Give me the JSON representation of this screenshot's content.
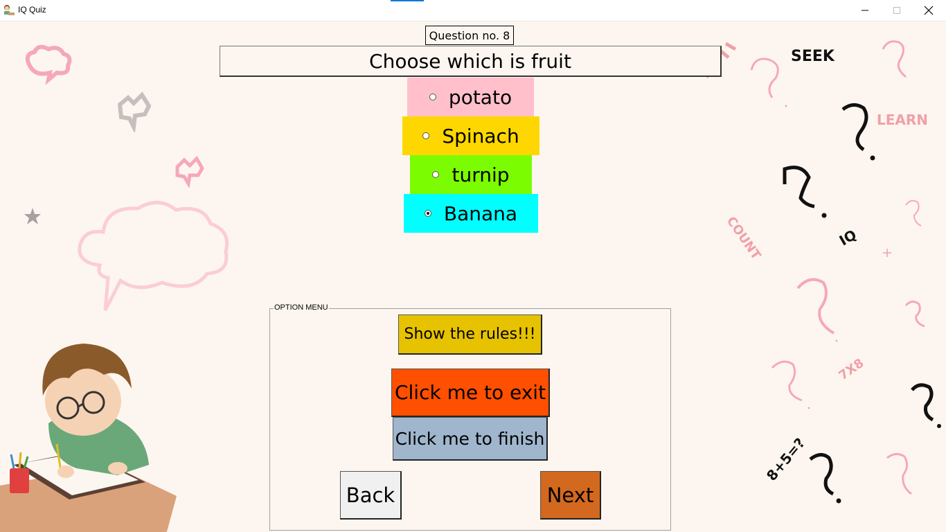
{
  "window": {
    "title": "IQ Quiz",
    "icon": "student-icon",
    "controls": [
      "minimize-icon",
      "maximize-icon",
      "close-icon"
    ]
  },
  "question": {
    "number_label": "Question no. 8",
    "text": "Choose which is fruit"
  },
  "options": [
    {
      "label": "potato",
      "color": "#ffc0cb",
      "selected": false
    },
    {
      "label": "Spinach",
      "color": "#ffd700",
      "selected": false
    },
    {
      "label": "turnip",
      "color": "#7cfc00",
      "selected": false
    },
    {
      "label": "Banana",
      "color": "#00ffff",
      "selected": true
    }
  ],
  "menu": {
    "label": "OPTION MENU",
    "rules_label": "Show the rules!!!",
    "exit_label": "Click me to exit",
    "finish_label": "Click me to finish",
    "back_label": "Back",
    "next_label": "Next"
  },
  "colors": {
    "rules": "#e6c200",
    "exit": "#ff4f00",
    "finish": "#9fb6cd",
    "back": "#f0f0f0",
    "next": "#d2691e",
    "background": "#fdf6f0"
  },
  "background_words": [
    "SEEK",
    "LEARN",
    "COUNT",
    "IQ",
    "7X8",
    "8+5=?"
  ]
}
